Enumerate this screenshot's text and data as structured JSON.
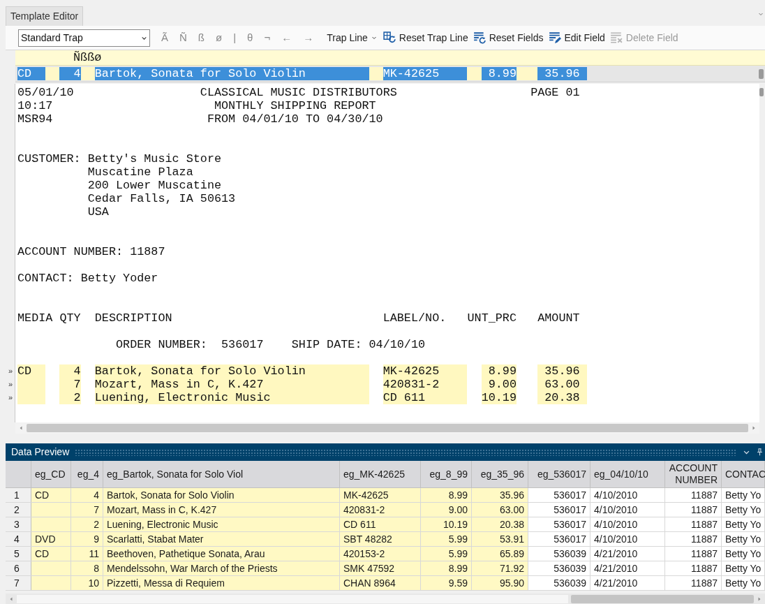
{
  "tab": {
    "label": "Template Editor",
    "selected": true
  },
  "toolbar": [
    {
      "kind": "select",
      "value": "Standard Trap"
    },
    {
      "kind": "glyph",
      "label": "Ã"
    },
    {
      "kind": "glyph",
      "label": "Ñ"
    },
    {
      "kind": "glyph",
      "label": "ß"
    },
    {
      "kind": "glyph",
      "label": "ø"
    },
    {
      "kind": "glyph",
      "label": "|"
    },
    {
      "kind": "glyph",
      "label": "θ"
    },
    {
      "kind": "glyph",
      "label": "¬"
    },
    {
      "kind": "glyph",
      "label": "←"
    },
    {
      "kind": "glyph",
      "label": "→"
    },
    {
      "kind": "dropdown",
      "label": "Trap Line"
    },
    {
      "kind": "button",
      "label": "Reset Trap Line",
      "disabled": false
    },
    {
      "kind": "button",
      "label": "Reset Fields",
      "disabled": false
    },
    {
      "kind": "button",
      "label": "Edit Field",
      "disabled": false
    },
    {
      "kind": "button",
      "label": "Delete Field",
      "disabled": true
    }
  ],
  "glyph_line": "Ñßßø",
  "trap_line": [
    "CD",
    "4",
    "Bartok, Sonata for Solo Violin",
    "MK-42625",
    "8.99",
    "35.96"
  ],
  "report": {
    "blocks": [
      [
        "05/01/10                  CLASSICAL MUSIC DISTRIBUTORS                   PAGE 01",
        "10:17                       MONTHLY SHIPPING REPORT",
        "MSR94                      FROM 04/01/10 TO 04/30/10"
      ],
      [
        "CUSTOMER: Betty's Music Store",
        "          Muscatine Plaza",
        "          200 Lower Muscatine",
        "          Cedar Falls, IA 50613",
        "          USA"
      ],
      [
        "ACCOUNT NUMBER: 11887"
      ],
      [
        "CONTACT: Betty Yoder"
      ],
      [
        "MEDIA QTY  DESCRIPTION                              LABEL/NO.   UNT_PRC   AMOUNT"
      ],
      [
        "              ORDER NUMBER:  536017    SHIP DATE: 04/10/10"
      ]
    ],
    "rows": [
      {
        "marker": "»",
        "media": "CD",
        "qty": "4",
        "description": "Bartok, Sonata for Solo Violin",
        "label": "MK-42625",
        "unit_price": "8.99",
        "amount": "35.96"
      },
      {
        "marker": "»",
        "qty": "7",
        "description": "Mozart, Mass in C, K.427",
        "label": "420831-2",
        "unit_price": "9.00",
        "amount": "63.00"
      },
      {
        "marker": "»",
        "qty": "2",
        "description": "Luening, Electronic Music",
        "label": "CD 611",
        "unit_price": "10.19",
        "amount": "20.38"
      }
    ]
  },
  "data_preview": {
    "title": "Data Preview",
    "columns": [
      {
        "label": "eg_CD",
        "highlighted": true
      },
      {
        "label": "eg_4",
        "highlighted": true
      },
      {
        "label": "eg_Bartok, Sonata for Solo Viol",
        "highlighted": true
      },
      {
        "label": "eg_MK-42625",
        "highlighted": true
      },
      {
        "label": "eg_8_99",
        "highlighted": true
      },
      {
        "label": "eg_35_96",
        "highlighted": true
      },
      {
        "label": "eg_536017",
        "highlighted": false
      },
      {
        "label": "eg_04/10/10",
        "highlighted": false
      },
      {
        "label": "ACCOUNT NUMBER",
        "highlighted": false
      },
      {
        "label": "CONTAC",
        "highlighted": false
      }
    ],
    "rows": [
      {
        "number": "1",
        "cells": [
          "CD",
          "4",
          "Bartok, Sonata for Solo Violin",
          "MK-42625",
          "8.99",
          "35.96",
          "536017",
          "4/10/2010",
          "11887",
          "Betty Yo"
        ]
      },
      {
        "number": "2",
        "cells": [
          null,
          "7",
          "Mozart, Mass in C, K.427",
          "420831-2",
          "9.00",
          "63.00",
          "536017",
          "4/10/2010",
          "11887",
          "Betty Yo"
        ]
      },
      {
        "number": "3",
        "cells": [
          null,
          "2",
          "Luening, Electronic Music",
          "CD 611",
          "10.19",
          "20.38",
          "536017",
          "4/10/2010",
          "11887",
          "Betty Yo"
        ]
      },
      {
        "number": "4",
        "cells": [
          "DVD",
          "9",
          "Scarlatti, Stabat Mater",
          "SBT 48282",
          "5.99",
          "53.91",
          "536017",
          "4/10/2010",
          "11887",
          "Betty Yo"
        ]
      },
      {
        "number": "5",
        "cells": [
          "CD",
          "11",
          "Beethoven, Pathetique Sonata, Arau",
          "420153-2",
          "5.99",
          "65.89",
          "536039",
          "4/21/2010",
          "11887",
          "Betty Yo"
        ]
      },
      {
        "number": "6",
        "cells": [
          null,
          "8",
          "Mendelssohn, War March of the Priests",
          "SMK 47592",
          "8.99",
          "71.92",
          "536039",
          "4/21/2010",
          "11887",
          "Betty Yo"
        ]
      },
      {
        "number": "7",
        "cells": [
          null,
          "10",
          "Pizzetti, Messa di Requiem",
          "CHAN 8964",
          "9.59",
          "95.90",
          "536039",
          "4/21/2010",
          "11887",
          "Betty Yo"
        ]
      }
    ]
  }
}
